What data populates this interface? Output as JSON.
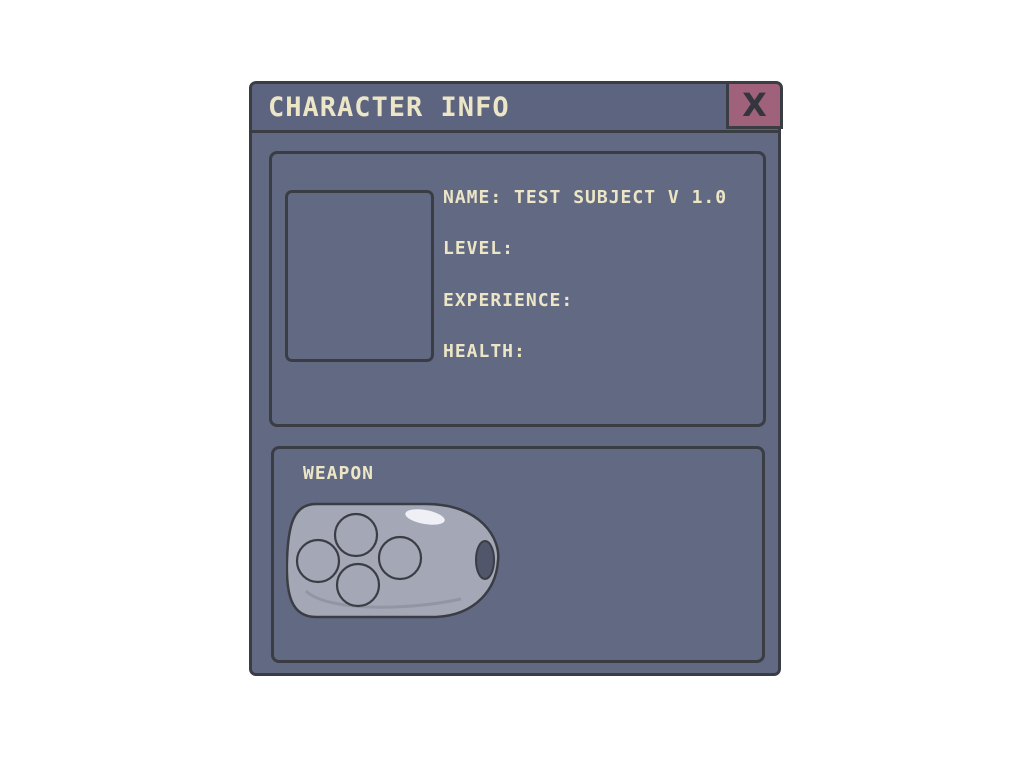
{
  "window": {
    "title": "CHARACTER INFO",
    "close_label": "X"
  },
  "character": {
    "name_line": "NAME: TEST SUBJECT V  1.0",
    "level_label": "LEVEL:",
    "experience_label": "EXPERIENCE:",
    "health_label": "HEALTH:"
  },
  "weapon": {
    "label": "WEAPON",
    "icon": "gamepad-weapon-icon"
  },
  "colors": {
    "panel": "#626a83",
    "titlebar": "#5c6480",
    "border": "#3b3d45",
    "text": "#ede6c6",
    "close_button": "#a0627a",
    "weapon_body": "#a4a8b6"
  }
}
